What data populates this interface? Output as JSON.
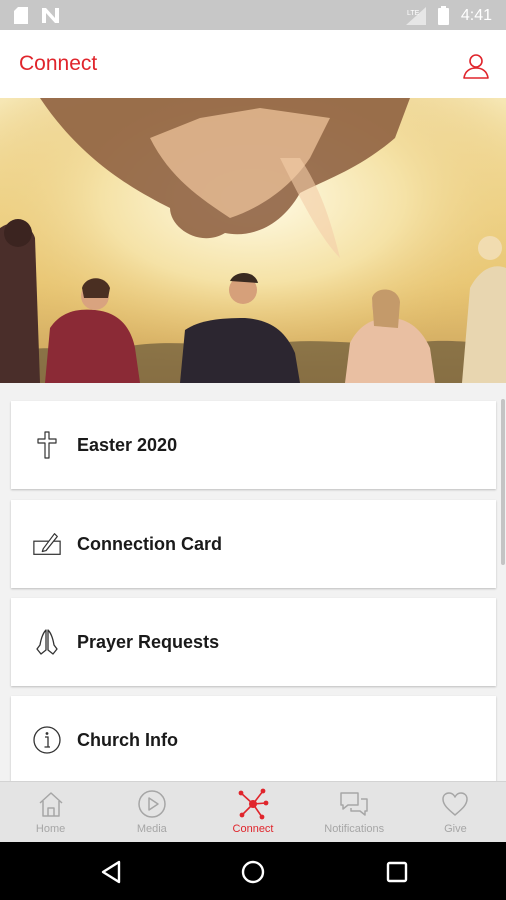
{
  "status_bar": {
    "time": "4:41",
    "icons": [
      "sim-card-icon",
      "n-logo-icon",
      "signal-lte-icon",
      "battery-icon"
    ]
  },
  "header": {
    "title": "Connect",
    "profile_icon": "user-icon"
  },
  "hero": {
    "description_icon": "photo"
  },
  "list_items": [
    {
      "label": "Easter 2020",
      "icon": "cross-icon"
    },
    {
      "label": "Connection Card",
      "icon": "pencil-card-icon"
    },
    {
      "label": "Prayer Requests",
      "icon": "praying-hands-icon"
    },
    {
      "label": "Church Info",
      "icon": "info-icon"
    }
  ],
  "bottom_nav": {
    "items": [
      {
        "label": "Home",
        "icon": "home-icon",
        "active": false
      },
      {
        "label": "Media",
        "icon": "play-icon",
        "active": false
      },
      {
        "label": "Connect",
        "icon": "network-icon",
        "active": true
      },
      {
        "label": "Notifications",
        "icon": "chat-bubbles-icon",
        "active": false
      },
      {
        "label": "Give",
        "icon": "heart-icon",
        "active": false
      }
    ]
  },
  "colors": {
    "accent": "#e0252c",
    "inactive": "#a6a6a6",
    "status_bar": "#c7c7c7"
  },
  "system_nav": {
    "icons": [
      "back-icon",
      "home-circle-icon",
      "recents-icon"
    ]
  }
}
